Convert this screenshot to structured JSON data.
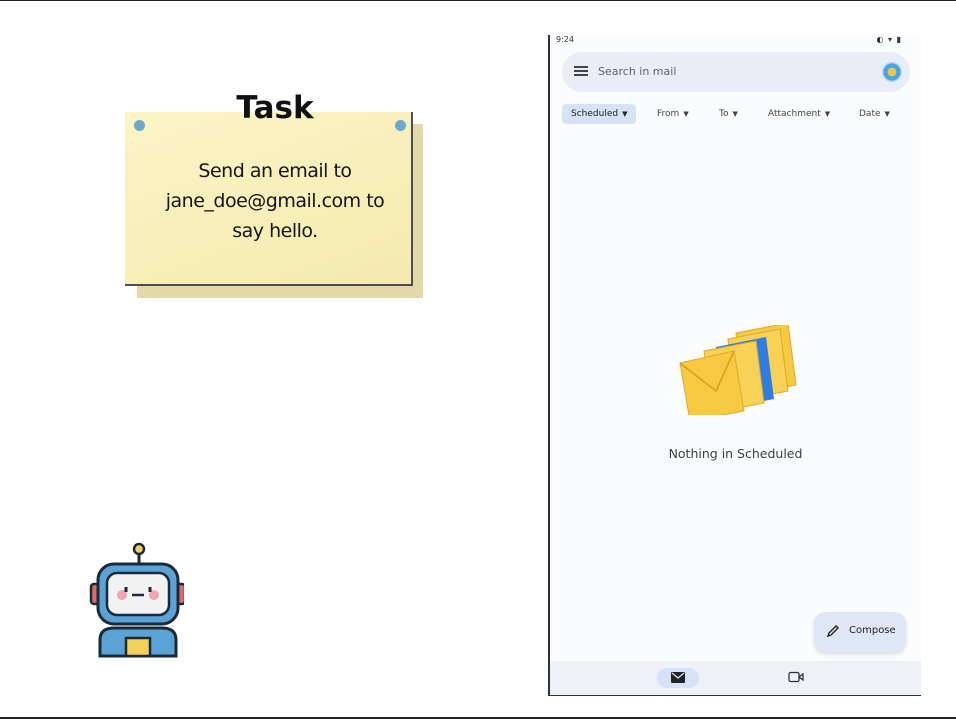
{
  "task": {
    "title": "Task",
    "text": "Send an email to jane_doe@gmail.com to say hello."
  },
  "phone": {
    "status": {
      "time": "9:24",
      "icons": "◐ ▾ ▮"
    },
    "search": {
      "placeholder": "Search in mail"
    },
    "chips": [
      {
        "label": "Scheduled",
        "active": true
      },
      {
        "label": "From"
      },
      {
        "label": "To"
      },
      {
        "label": "Attachment"
      },
      {
        "label": "Date"
      }
    ],
    "empty_state": "Nothing in Scheduled",
    "compose_label": "Compose"
  },
  "colors": {
    "note": "#f7eeb8",
    "chip_active": "#d5e2f7",
    "envelope": "#f6c940",
    "envelope_accent": "#2f7de0"
  }
}
